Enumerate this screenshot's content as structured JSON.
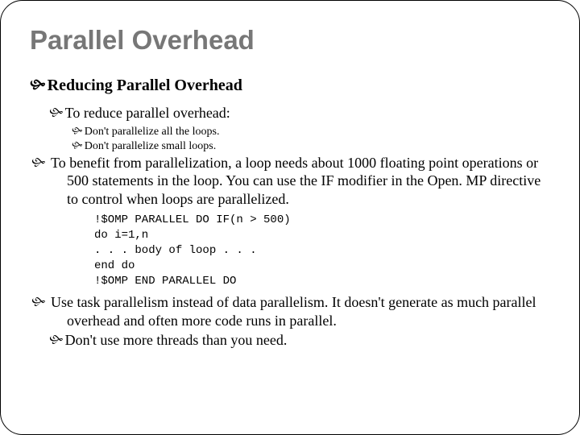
{
  "title": "Parallel Overhead",
  "lvl1": {
    "text": "Reducing Parallel Overhead"
  },
  "lvl2a": {
    "text": "To reduce parallel overhead:"
  },
  "lvl3a": {
    "text": "Don't parallelize all the loops."
  },
  "lvl3b": {
    "text": "Don't parallelize small loops."
  },
  "lvl2b": {
    "text": "To benefit from parallelization, a loop needs about 1000 floating point operations or 500 statements in the loop. You can use the IF modifier in the Open. MP directive to control when loops are parallelized."
  },
  "code": "!$OMP PARALLEL DO IF(n > 500)\ndo i=1,n\n. . . body of loop . . .\nend do\n!$OMP END PARALLEL DO",
  "lvl2c": {
    "text": "Use task parallelism instead of data parallelism. It doesn't generate as much parallel overhead and often more code runs in parallel."
  },
  "lvl2d": {
    "text": "Don't use more threads than you need."
  },
  "bullet": "་"
}
